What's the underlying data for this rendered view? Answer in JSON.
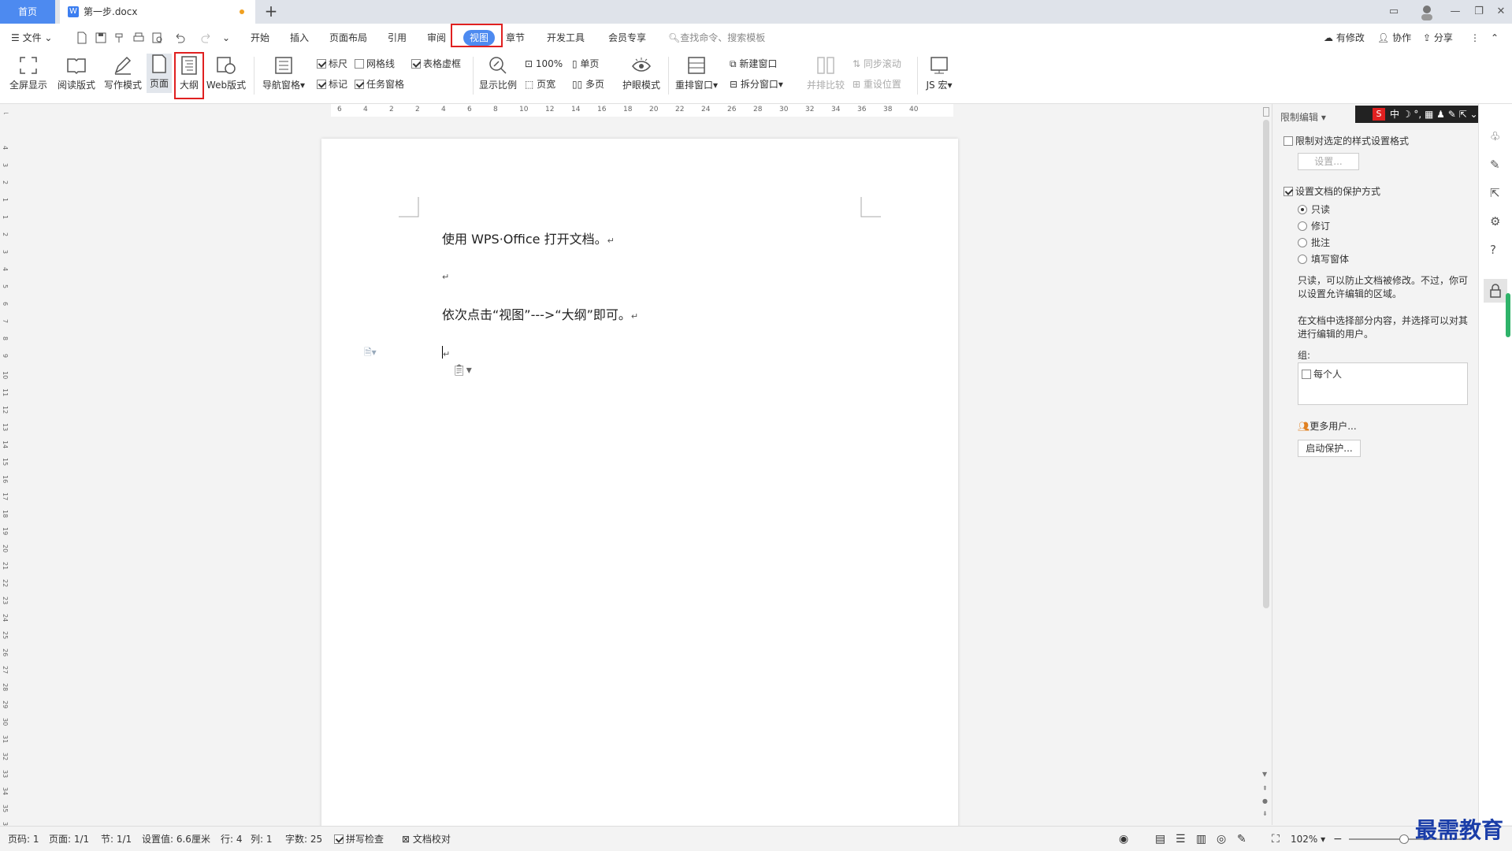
{
  "tabs": {
    "home": "首页",
    "doc_name": "第一步.docx",
    "add": "+"
  },
  "window": {
    "min": "—",
    "restore": "❐",
    "close": "✕"
  },
  "menu": {
    "file": "文件",
    "items": [
      "开始",
      "插入",
      "页面布局",
      "引用",
      "审阅",
      "视图",
      "章节",
      "开发工具",
      "会员专享"
    ],
    "search": "查找命令、搜索模板",
    "right": [
      "有修改",
      "协作",
      "分享"
    ]
  },
  "ribbon": {
    "fullscreen": "全屏显示",
    "read": "阅读版式",
    "write": "写作模式",
    "page": "页面",
    "outline": "大纲",
    "web": "Web版式",
    "nav": "导航窗格",
    "chk_ruler": "标尺",
    "chk_grid": "网格线",
    "chk_table": "表格虚框",
    "chk_mark": "标记",
    "chk_task": "任务窗格",
    "zoom": "显示比例",
    "zoom100": "100%",
    "pagewidth": "页宽",
    "single": "单页",
    "multi": "多页",
    "eye": "护眼模式",
    "arrange": "重排窗口",
    "newwin": "新建窗口",
    "split": "拆分窗口",
    "compare": "并排比较",
    "sync": "同步滚动",
    "reset": "重设位置",
    "js": "JS 宏"
  },
  "ruler": {
    "top": [
      "6",
      "4",
      "2",
      "2",
      "4",
      "6",
      "8",
      "10",
      "12",
      "14",
      "16",
      "18",
      "20",
      "22",
      "24",
      "26",
      "28",
      "30",
      "32",
      "34",
      "36",
      "38",
      "40"
    ],
    "left": [
      "4",
      "3",
      "2",
      "1",
      "1",
      "2",
      "3",
      "4",
      "5",
      "6",
      "7",
      "8",
      "9",
      "10",
      "11",
      "12",
      "13",
      "14",
      "15",
      "16",
      "17",
      "18",
      "19",
      "20",
      "21",
      "22",
      "23",
      "24",
      "25",
      "26",
      "27",
      "28",
      "29",
      "30",
      "31",
      "32",
      "33",
      "34",
      "35",
      "36"
    ]
  },
  "doc": {
    "line1": "使用 WPS·Office 打开文档。",
    "line3": "依次点击“视图”--->“大纲”即可。",
    "pilcrow": "↵"
  },
  "pane": {
    "title": "限制编辑",
    "style_restrict": "限制对选定的样式设置格式",
    "settings_btn": "设置...",
    "protect": "设置文档的保护方式",
    "opt_readonly": "只读",
    "opt_revise": "修订",
    "opt_comment": "批注",
    "opt_form": "填写窗体",
    "desc1a": "只读，可以防止文档被修改。不过，你可",
    "desc1b": "以设置允许编辑的区域。",
    "desc2a": "在文档中选择部分内容，并选择可以对其",
    "desc2b": "进行编辑的用户。",
    "group": "组:",
    "everyone": "每个人",
    "more_users": "更多用户...",
    "start_btn": "启动保护..."
  },
  "status": {
    "page": "页码: 1",
    "pages": "页面: 1/1",
    "section": "节: 1/1",
    "setting": "设置值: 6.6厘米",
    "row": "行: 4",
    "col": "列: 1",
    "words": "字数: 25",
    "spell": "拼写检查",
    "proof": "文档校对",
    "zoom": "102%"
  },
  "watermark": "最需教育",
  "colors": {
    "accent": "#4d8af0",
    "highlight": "#e02020",
    "doc_icon": "#3c7ef0"
  }
}
